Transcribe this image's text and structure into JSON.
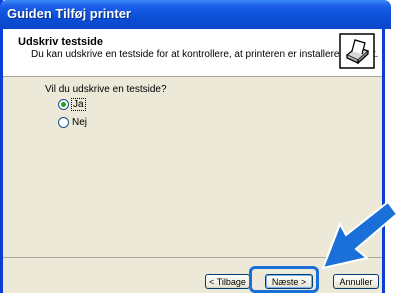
{
  "window": {
    "title": "Guiden Tilføj printer"
  },
  "header": {
    "title": "Udskriv testside",
    "subtitle": "Du kan udskrive en testside for at kontrollere, at printeren er installeret korrekt.",
    "icon": "printer-icon"
  },
  "body": {
    "question": "Vil du udskrive en testside?",
    "options": [
      {
        "label": "Ja",
        "selected": true
      },
      {
        "label": "Nej",
        "selected": false
      }
    ]
  },
  "buttons": {
    "back": "< Tilbage",
    "next": "Næste >",
    "cancel": "Annuller"
  },
  "annotation": {
    "highlight_color": "#1a6fd8",
    "arrow_color": "#1a6fd8",
    "arrow_icon": "pointer-arrow-icon"
  }
}
